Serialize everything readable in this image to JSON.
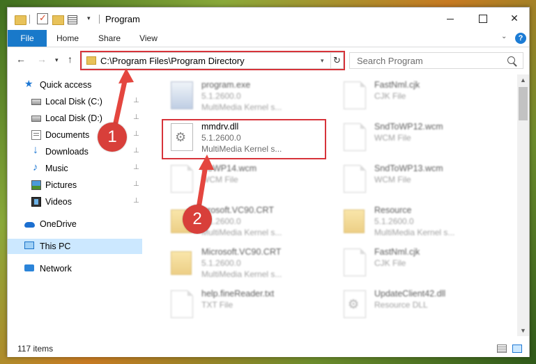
{
  "window": {
    "title": "Program",
    "minimize_label": "",
    "maximize_label": "",
    "close_label": "✕"
  },
  "ribbon": {
    "tabs": [
      "File",
      "Home",
      "Share",
      "View"
    ]
  },
  "nav": {
    "back": "←",
    "forward": "→",
    "recent": "⌄",
    "up": "↑",
    "address": "C:\\Program Files\\Program Directory",
    "refresh": "↻",
    "dropdown": "⌄",
    "search_placeholder": "Search Program"
  },
  "sidebar": {
    "items": [
      {
        "label": "Quick access",
        "icon": "quick-access-icon",
        "pinned": false
      },
      {
        "label": "Local Disk (C:)",
        "icon": "disk-icon",
        "pinned": true
      },
      {
        "label": "Local Disk (D:)",
        "icon": "disk-icon",
        "pinned": true
      },
      {
        "label": "Documents",
        "icon": "documents-icon",
        "pinned": true
      },
      {
        "label": "Downloads",
        "icon": "downloads-icon",
        "pinned": true
      },
      {
        "label": "Music",
        "icon": "music-icon",
        "pinned": true
      },
      {
        "label": "Pictures",
        "icon": "pictures-icon",
        "pinned": true
      },
      {
        "label": "Videos",
        "icon": "videos-icon",
        "pinned": true
      },
      {
        "label": "OneDrive",
        "icon": "onedrive-icon",
        "pinned": false
      },
      {
        "label": "This PC",
        "icon": "this-pc-icon",
        "pinned": false,
        "selected": true
      },
      {
        "label": "Network",
        "icon": "network-icon",
        "pinned": false
      }
    ],
    "pin_glyph": "📌"
  },
  "files": {
    "left": [
      {
        "name": "program.exe",
        "line2": "5.1.2600.0",
        "line3": "MultiMedia Kernel s...",
        "type": "exe",
        "blurred": true
      },
      {
        "name": "mmdrv.dll",
        "line2": "5.1.2600.0",
        "line3": "MultiMedia Kernel s...",
        "type": "dll",
        "blurred": false
      },
      {
        "name": "iToWP14.wcm",
        "line2": "WCM File",
        "line3": "",
        "type": "doc",
        "blurred": true
      },
      {
        "name": "icrosoft.VC90.CRT",
        "line2": "5.1.2600.0",
        "line3": "MultiMedia Kernel s...",
        "type": "folder",
        "blurred": true
      },
      {
        "name": "Microsoft.VC90.CRT",
        "line2": "5.1.2600.0",
        "line3": "MultiMedia Kernel s...",
        "type": "folder",
        "blurred": true
      },
      {
        "name": "help.fineReader.txt",
        "line2": "TXT File",
        "line3": "",
        "type": "doc",
        "blurred": true
      }
    ],
    "right": [
      {
        "name": "FastNml.cjk",
        "line2": "CJK File",
        "line3": "",
        "type": "doc",
        "blurred": true
      },
      {
        "name": "SndToWP12.wcm",
        "line2": "WCM File",
        "line3": "",
        "type": "doc",
        "blurred": true
      },
      {
        "name": "SndToWP13.wcm",
        "line2": "WCM File",
        "line3": "",
        "type": "doc",
        "blurred": true
      },
      {
        "name": "Resource",
        "line2": "5.1.2600.0",
        "line3": "MultiMedia Kernel s...",
        "type": "folder",
        "blurred": true
      },
      {
        "name": "FastNml.cjk",
        "line2": "CJK File",
        "line3": "",
        "type": "doc",
        "blurred": true
      },
      {
        "name": "UpdateClient42.dll",
        "line2": "Resource DLL",
        "line3": "",
        "type": "dll",
        "blurred": true
      }
    ]
  },
  "status": {
    "item_count": "117 items"
  },
  "callouts": {
    "one": "1",
    "two": "2"
  },
  "colors": {
    "accent": "#1979ca",
    "highlight": "#d7333a",
    "callout": "#d83f3a",
    "selected": "#cce8ff"
  }
}
